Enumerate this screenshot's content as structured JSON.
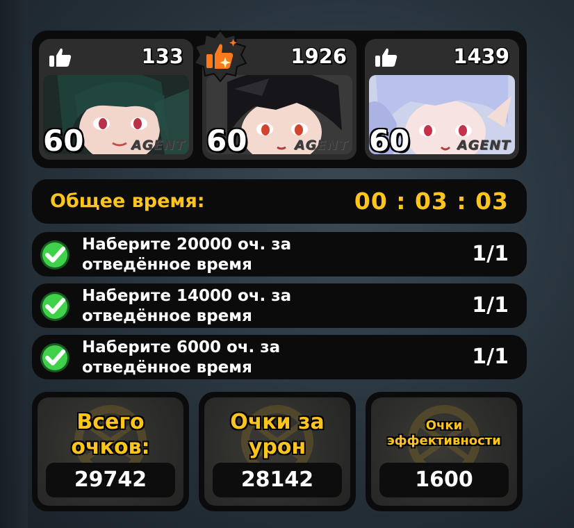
{
  "agents": [
    {
      "likes": "133",
      "level": "60",
      "tag": "AGENT",
      "mvp": false
    },
    {
      "likes": "1926",
      "level": "60",
      "tag": "AGENT",
      "mvp": true
    },
    {
      "likes": "1439",
      "level": "60",
      "tag": "AGENT",
      "mvp": false
    }
  ],
  "time": {
    "label": "Общее время:",
    "value": "00 : 03 : 03"
  },
  "objectives": [
    {
      "line1": "Наберите 20000 оч. за",
      "line2": "отведённое время",
      "progress": "1/1",
      "done": true
    },
    {
      "line1": "Наберите 14000 оч. за",
      "line2": "отведённое время",
      "progress": "1/1",
      "done": true
    },
    {
      "line1": "Наберите 6000 оч. за",
      "line2": "отведённое время",
      "progress": "1/1",
      "done": true
    }
  ],
  "scores": [
    {
      "line1": "Всего",
      "line2": "очков:",
      "value": "29742"
    },
    {
      "line1": "Очки за",
      "line2": "урон",
      "value": "28142"
    },
    {
      "line1": "Очки",
      "line2": "эффективности",
      "value": "1600"
    }
  ],
  "colors": {
    "accent": "#ffc51c",
    "check": "#3fd14a",
    "panel": "#0b0b0b",
    "card": "#2d2d2d"
  }
}
